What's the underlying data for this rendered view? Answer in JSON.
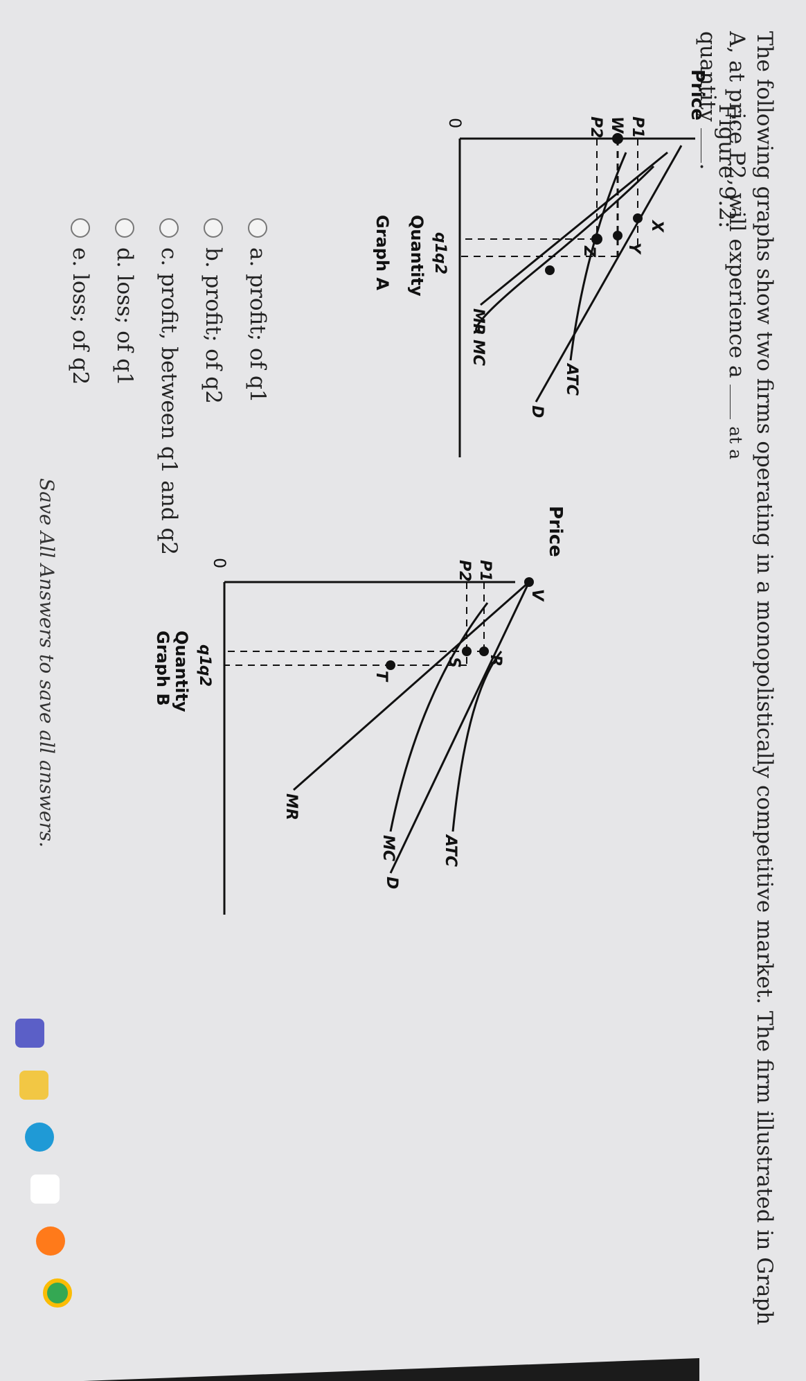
{
  "question": {
    "text_before": "The following graphs show two firms operating in a monopolistically competitive market. The firm illustrated in Graph A, at price P2, will experience a",
    "text_after": "at a",
    "line2": "quantity"
  },
  "figure_label": "Figure 9.2:",
  "graph_a": {
    "y_axis": "Price",
    "x_axis": "Quantity",
    "caption": "Graph A",
    "origin": "0",
    "price_labels": [
      "P1",
      "W",
      "P2"
    ],
    "quantity_labels": [
      "q1",
      "q2"
    ],
    "point_labels": [
      "X",
      "Y",
      "Z"
    ],
    "curve_labels": [
      "MC",
      "ATC",
      "D",
      "MR"
    ]
  },
  "graph_b": {
    "y_axis": "Price",
    "x_axis": "Quantity",
    "caption": "Graph B",
    "origin": "0",
    "price_labels": [
      "P1",
      "P2"
    ],
    "quantity_labels": [
      "q1",
      "q2"
    ],
    "point_labels": [
      "V",
      "R",
      "S",
      "T"
    ],
    "curve_labels": [
      "MC",
      "ATC",
      "D",
      "MR"
    ]
  },
  "choices": [
    "a. profit; of q1",
    "b. profit; of q2",
    "c. profit, between q1 and q2",
    "d. loss; of q1",
    "e. loss; of q2"
  ],
  "save_note": "Save All Answers to save all answers.",
  "taskbar": {
    "icons": [
      "chat-icon",
      "file-explorer-icon",
      "edge-icon",
      "store-icon",
      "firefox-icon",
      "chrome-icon"
    ],
    "colors": {
      "screen": "#e6e6e8",
      "bezel": "#1b1b1b"
    }
  }
}
